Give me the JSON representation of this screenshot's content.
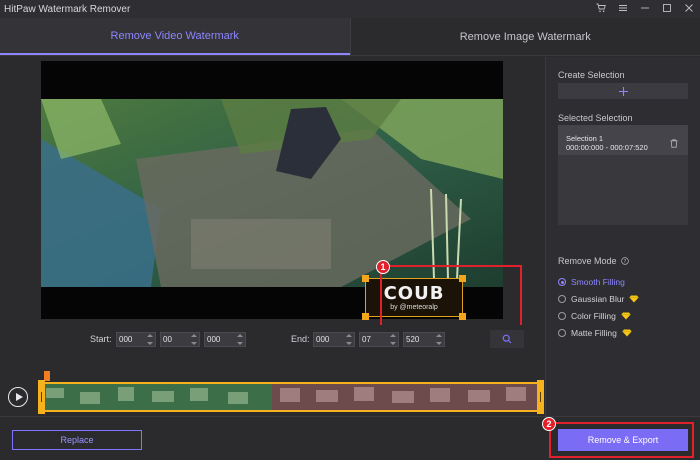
{
  "window": {
    "title": "HitPaw Watermark Remover"
  },
  "tabs": [
    {
      "label": "Remove Video Watermark",
      "active": true
    },
    {
      "label": "Remove Image Watermark",
      "active": false
    }
  ],
  "watermark": {
    "title": "COUB",
    "subtitle": "by @meteoralp"
  },
  "callouts": {
    "one": "1",
    "two": "2"
  },
  "time": {
    "start_label": "Start:",
    "start": [
      "000",
      "00",
      "000"
    ],
    "end_label": "End:",
    "end": [
      "000",
      "07",
      "520"
    ]
  },
  "timeline": {
    "playhead_position": 0.0
  },
  "buttons": {
    "replace": "Replace",
    "export": "Remove & Export"
  },
  "panel": {
    "create_selection": "Create Selection",
    "selected_selection": "Selected Selection",
    "selection": {
      "name": "Selection 1",
      "range": "000:00:000 - 000:07:520"
    },
    "remove_mode": "Remove Mode",
    "modes": [
      {
        "label": "Smooth Filling",
        "selected": true,
        "premium": false
      },
      {
        "label": "Gaussian Blur",
        "selected": false,
        "premium": true
      },
      {
        "label": "Color Filling",
        "selected": false,
        "premium": true
      },
      {
        "label": "Matte Filling",
        "selected": false,
        "premium": true
      }
    ]
  },
  "colors": {
    "accent": "#8d86ff",
    "export": "#7b6cf6",
    "highlight": "#e0202a",
    "selection": "#f5a51c",
    "premium": "#f5c518"
  },
  "icons": [
    "cart-icon",
    "menu-icon",
    "minimize-icon",
    "maximize-icon",
    "close-icon",
    "plus-icon",
    "trash-icon",
    "help-icon",
    "search-icon",
    "play-icon",
    "gem-icon"
  ]
}
